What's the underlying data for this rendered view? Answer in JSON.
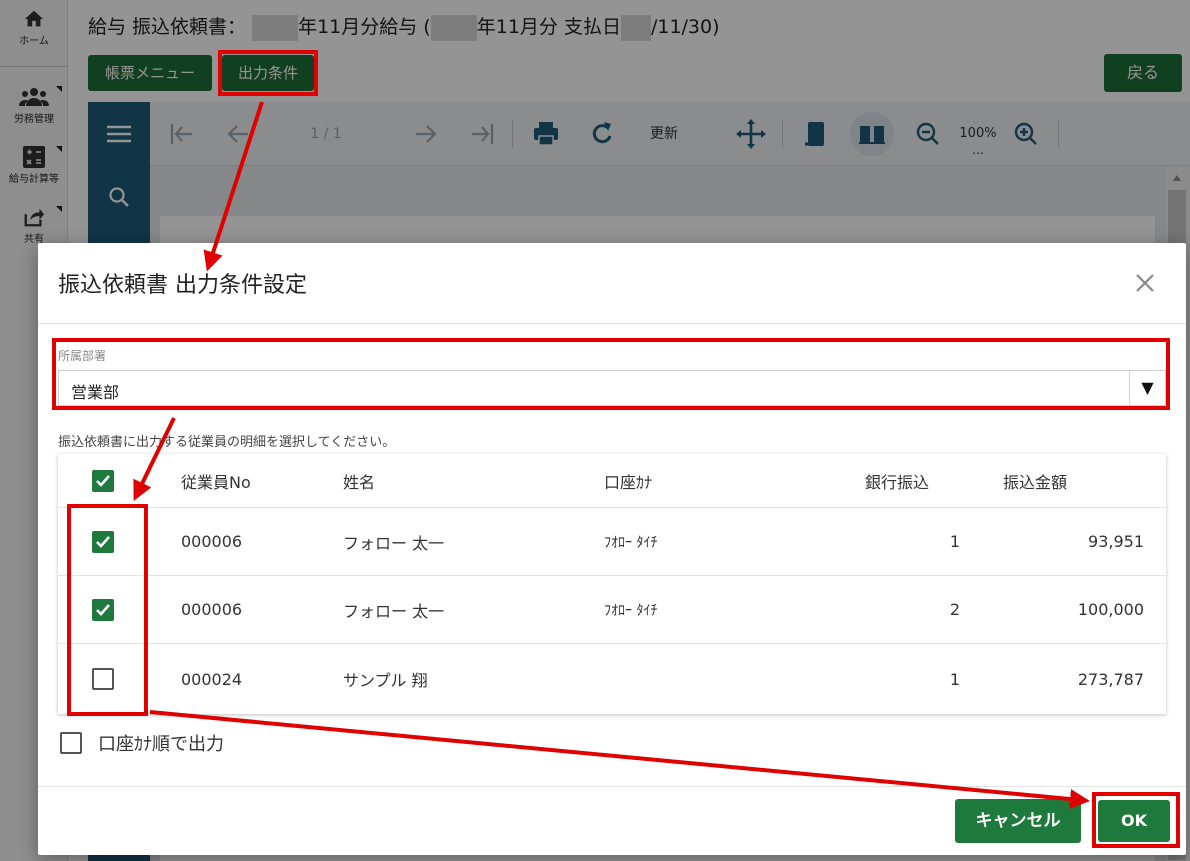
{
  "sidebar": {
    "items": [
      {
        "label": "ホーム",
        "icon": "home-icon"
      },
      {
        "label": "労務管理",
        "icon": "people-icon"
      },
      {
        "label": "給与計算等",
        "icon": "calculator-icon"
      },
      {
        "label": "共有",
        "icon": "share-icon"
      }
    ]
  },
  "page": {
    "title_prefix": "給与 振込依頼書：",
    "title_mid": "年11月分給与 (",
    "title_mid2": "年11月分 支払日",
    "title_end": "/11/30)"
  },
  "toolbar": {
    "menu_label": "帳票メニュー",
    "condition_label": "出力条件",
    "back_label": "戻る"
  },
  "viewer": {
    "page_indicator": "1 / 1",
    "refresh_label": "更新",
    "zoom": "100%",
    "zoom_more": "..."
  },
  "dialog": {
    "title": "振込依頼書 出力条件設定",
    "department_label": "所属部署",
    "department_value": "営業部",
    "instruction": "振込依頼書に出力する従業員の明細を選択してください。",
    "columns": [
      "従業員No",
      "姓名",
      "口座ｶﾅ",
      "銀行振込",
      "振込金額"
    ],
    "header_checked": true,
    "rows": [
      {
        "checked": true,
        "no": "000006",
        "name": "フォロー 太一",
        "kana": "ﾌｵﾛｰ ﾀｲﾁ",
        "bank": "1",
        "amount": "93,951"
      },
      {
        "checked": true,
        "no": "000006",
        "name": "フォロー 太一",
        "kana": "ﾌｵﾛｰ ﾀｲﾁ",
        "bank": "2",
        "amount": "100,000"
      },
      {
        "checked": false,
        "no": "000024",
        "name": "サンプル 翔",
        "kana": "",
        "bank": "1",
        "amount": "273,787"
      }
    ],
    "kana_order_label": "口座ｶﾅ順で出力",
    "kana_order_checked": false,
    "cancel_label": "キャンセル",
    "ok_label": "OK"
  },
  "colors": {
    "primary_green": "#1e7a3c",
    "annotation_red": "#e00000",
    "viewer_blue": "#1f5a7a"
  }
}
